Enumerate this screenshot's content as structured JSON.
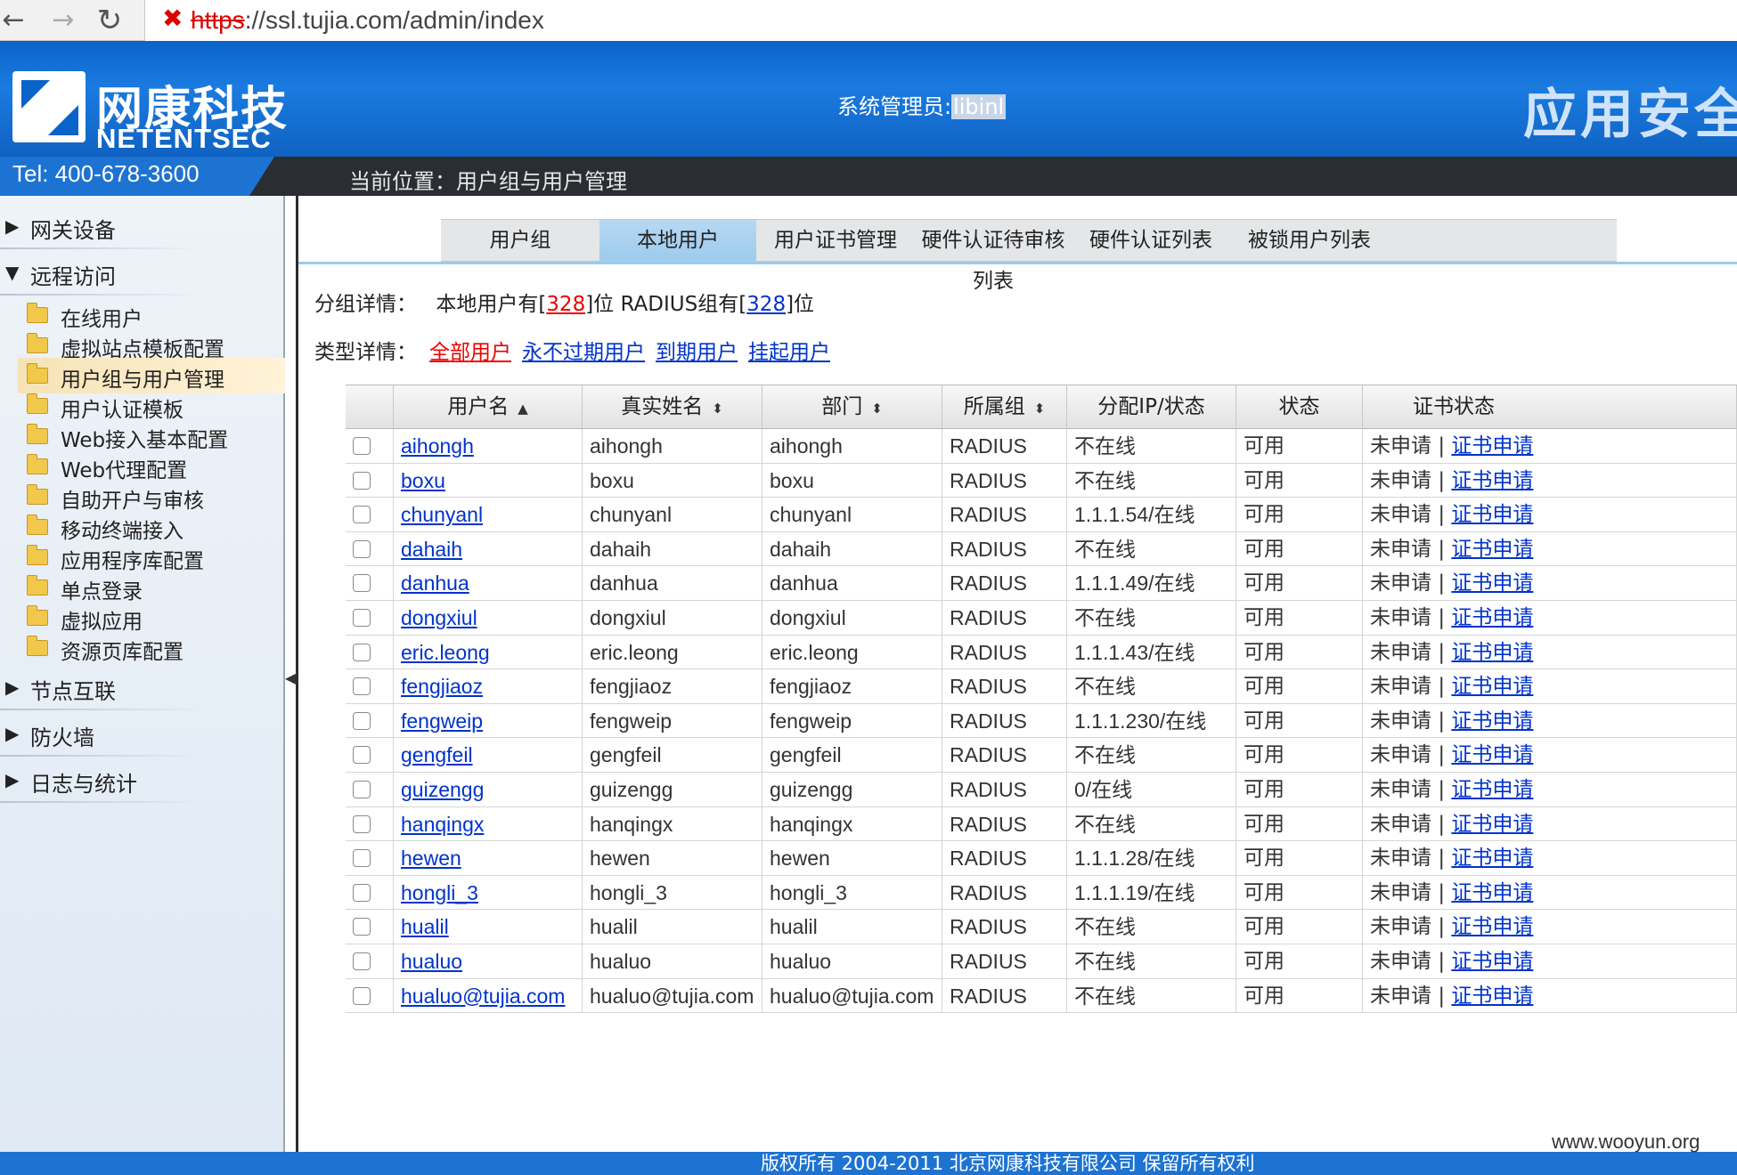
{
  "browser": {
    "url_scheme": "https",
    "url_rest": "://ssl.tujia.com/admin/index"
  },
  "header": {
    "logo_cn": "网康科技",
    "logo_en": "NETENTSEC",
    "admin_prefix": "系统管理员:",
    "admin_name": "libinl",
    "app_title": "应用安全网",
    "tel": "Tel: 400-678-3600",
    "location": "当前位置：用户组与用户管理"
  },
  "sidebar": {
    "sections": [
      {
        "label": "网关设备",
        "expanded": false
      },
      {
        "label": "远程访问",
        "expanded": true
      },
      {
        "label": "节点互联",
        "expanded": false
      },
      {
        "label": "防火墙",
        "expanded": false
      },
      {
        "label": "日志与统计",
        "expanded": false
      }
    ],
    "items": [
      {
        "label": "在线用户"
      },
      {
        "label": "虚拟站点模板配置"
      },
      {
        "label": "用户组与用户管理"
      },
      {
        "label": "用户认证模板"
      },
      {
        "label": "Web接入基本配置"
      },
      {
        "label": "Web代理配置"
      },
      {
        "label": "自助开户与审核"
      },
      {
        "label": "移动终端接入"
      },
      {
        "label": "应用程序库配置"
      },
      {
        "label": "单点登录"
      },
      {
        "label": "虚拟应用"
      },
      {
        "label": "资源页库配置"
      }
    ],
    "active_item": "用户组与用户管理"
  },
  "tabs": [
    {
      "label": "用户组"
    },
    {
      "label": "本地用户"
    },
    {
      "label": "用户证书管理"
    },
    {
      "label": "硬件认证待审核列表"
    },
    {
      "label": "硬件认证列表"
    },
    {
      "label": "被锁用户列表"
    }
  ],
  "active_tab": "本地用户",
  "group_detail": {
    "label": "分组详情：",
    "part1": "本地用户有[",
    "local_count": "328",
    "part2": "]位 RADIUS组有[",
    "radius_count": "328",
    "part3": "]位"
  },
  "type_detail": {
    "label": "类型详情：",
    "links": [
      "全部用户",
      "永不过期用户",
      "到期用户",
      "挂起用户"
    ]
  },
  "table": {
    "columns": [
      "用户名",
      "真实姓名",
      "部门",
      "所属组",
      "分配IP/状态",
      "状态",
      "证书状态"
    ],
    "sort_arrows": {
      "username": "▲",
      "sortable": "⬍"
    },
    "cert_not_applied": "未申请",
    "cert_sep": "|",
    "cert_link": "证书申请",
    "rows": [
      {
        "username": "aihongh",
        "realname": "aihongh",
        "dept": "aihongh",
        "group": "RADIUS",
        "ip": "不在线",
        "status": "可用"
      },
      {
        "username": "boxu",
        "realname": "boxu",
        "dept": "boxu",
        "group": "RADIUS",
        "ip": "不在线",
        "status": "可用"
      },
      {
        "username": "chunyanl",
        "realname": "chunyanl",
        "dept": "chunyanl",
        "group": "RADIUS",
        "ip": "1.1.1.54/在线",
        "status": "可用"
      },
      {
        "username": "dahaih",
        "realname": "dahaih",
        "dept": "dahaih",
        "group": "RADIUS",
        "ip": "不在线",
        "status": "可用"
      },
      {
        "username": "danhua",
        "realname": "danhua",
        "dept": "danhua",
        "group": "RADIUS",
        "ip": "1.1.1.49/在线",
        "status": "可用"
      },
      {
        "username": "dongxiul",
        "realname": "dongxiul",
        "dept": "dongxiul",
        "group": "RADIUS",
        "ip": "不在线",
        "status": "可用"
      },
      {
        "username": "eric.leong",
        "realname": "eric.leong",
        "dept": "eric.leong",
        "group": "RADIUS",
        "ip": "1.1.1.43/在线",
        "status": "可用"
      },
      {
        "username": "fengjiaoz",
        "realname": "fengjiaoz",
        "dept": "fengjiaoz",
        "group": "RADIUS",
        "ip": "不在线",
        "status": "可用"
      },
      {
        "username": "fengweip",
        "realname": "fengweip",
        "dept": "fengweip",
        "group": "RADIUS",
        "ip": "1.1.1.230/在线",
        "status": "可用"
      },
      {
        "username": "gengfeil",
        "realname": "gengfeil",
        "dept": "gengfeil",
        "group": "RADIUS",
        "ip": "不在线",
        "status": "可用"
      },
      {
        "username": "guizengg",
        "realname": "guizengg",
        "dept": "guizengg",
        "group": "RADIUS",
        "ip": "0/在线",
        "status": "可用"
      },
      {
        "username": "hanqingx",
        "realname": "hanqingx",
        "dept": "hanqingx",
        "group": "RADIUS",
        "ip": "不在线",
        "status": "可用"
      },
      {
        "username": "hewen",
        "realname": "hewen",
        "dept": "hewen",
        "group": "RADIUS",
        "ip": "1.1.1.28/在线",
        "status": "可用"
      },
      {
        "username": "hongli_3",
        "realname": "hongli_3",
        "dept": "hongli_3",
        "group": "RADIUS",
        "ip": "1.1.1.19/在线",
        "status": "可用"
      },
      {
        "username": "hualil",
        "realname": "hualil",
        "dept": "hualil",
        "group": "RADIUS",
        "ip": "不在线",
        "status": "可用"
      },
      {
        "username": "hualuo",
        "realname": "hualuo",
        "dept": "hualuo",
        "group": "RADIUS",
        "ip": "不在线",
        "status": "可用"
      },
      {
        "username": "hualuo@tujia.com",
        "realname": "hualuo@tujia.com",
        "dept": "hualuo@tujia.com",
        "group": "RADIUS",
        "ip": "不在线",
        "status": "可用"
      }
    ]
  },
  "footer": {
    "copyright": "版权所有 2004-2011 北京网康科技有限公司 保留所有权利",
    "watermark": "www.wooyun.org"
  }
}
